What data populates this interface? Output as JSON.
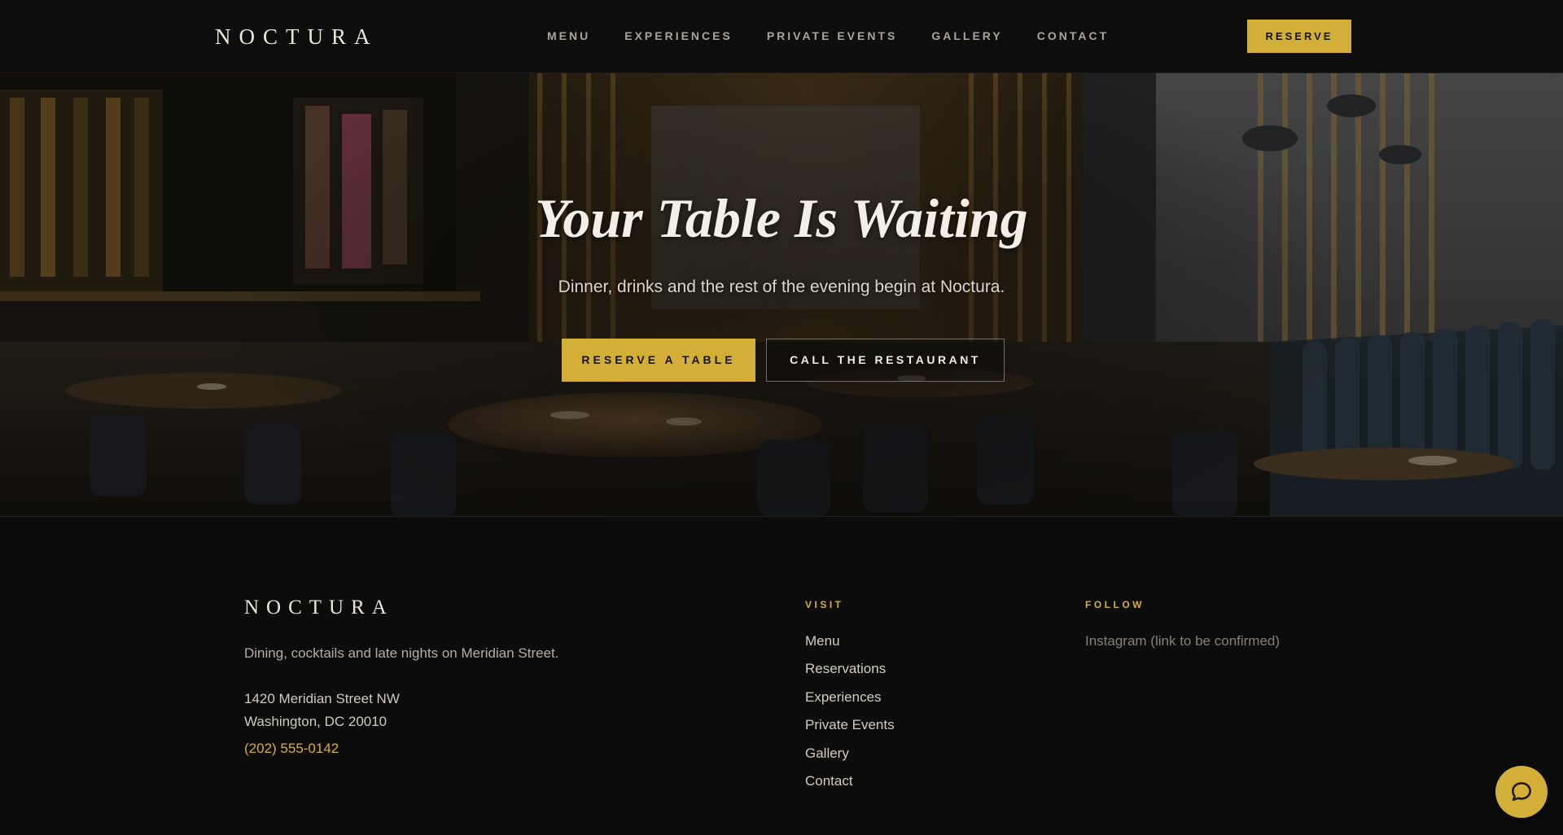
{
  "header": {
    "logo": "NOCTURA",
    "nav": [
      {
        "label": "MENU"
      },
      {
        "label": "EXPERIENCES"
      },
      {
        "label": "PRIVATE EVENTS"
      },
      {
        "label": "GALLERY"
      },
      {
        "label": "CONTACT"
      }
    ],
    "reserve_label": "RESERVE"
  },
  "hero": {
    "title": "Your Table Is Waiting",
    "subtitle": "Dinner, drinks and the rest of the evening begin at Noctura.",
    "primary_cta": "RESERVE A TABLE",
    "secondary_cta": "CALL THE RESTAURANT",
    "background_image": "restaurant-dining-room-photo"
  },
  "footer": {
    "logo": "NOCTURA",
    "tagline": "Dining, cocktails and late nights on Meridian Street.",
    "address_line1": "1420 Meridian Street NW",
    "address_line2": "Washington, DC 20010",
    "phone": "(202) 555-0142",
    "visit": {
      "heading": "VISIT",
      "links": [
        {
          "label": "Menu"
        },
        {
          "label": "Reservations"
        },
        {
          "label": "Experiences"
        },
        {
          "label": "Private Events"
        },
        {
          "label": "Gallery"
        },
        {
          "label": "Contact"
        }
      ]
    },
    "follow": {
      "heading": "FOLLOW",
      "text": "Instagram (link to be confirmed)"
    }
  },
  "chat": {
    "icon": "chat-bubble-icon"
  },
  "colors": {
    "accent": "#d4af37",
    "background": "#0c0c0c",
    "text": "#e8e4dc"
  }
}
